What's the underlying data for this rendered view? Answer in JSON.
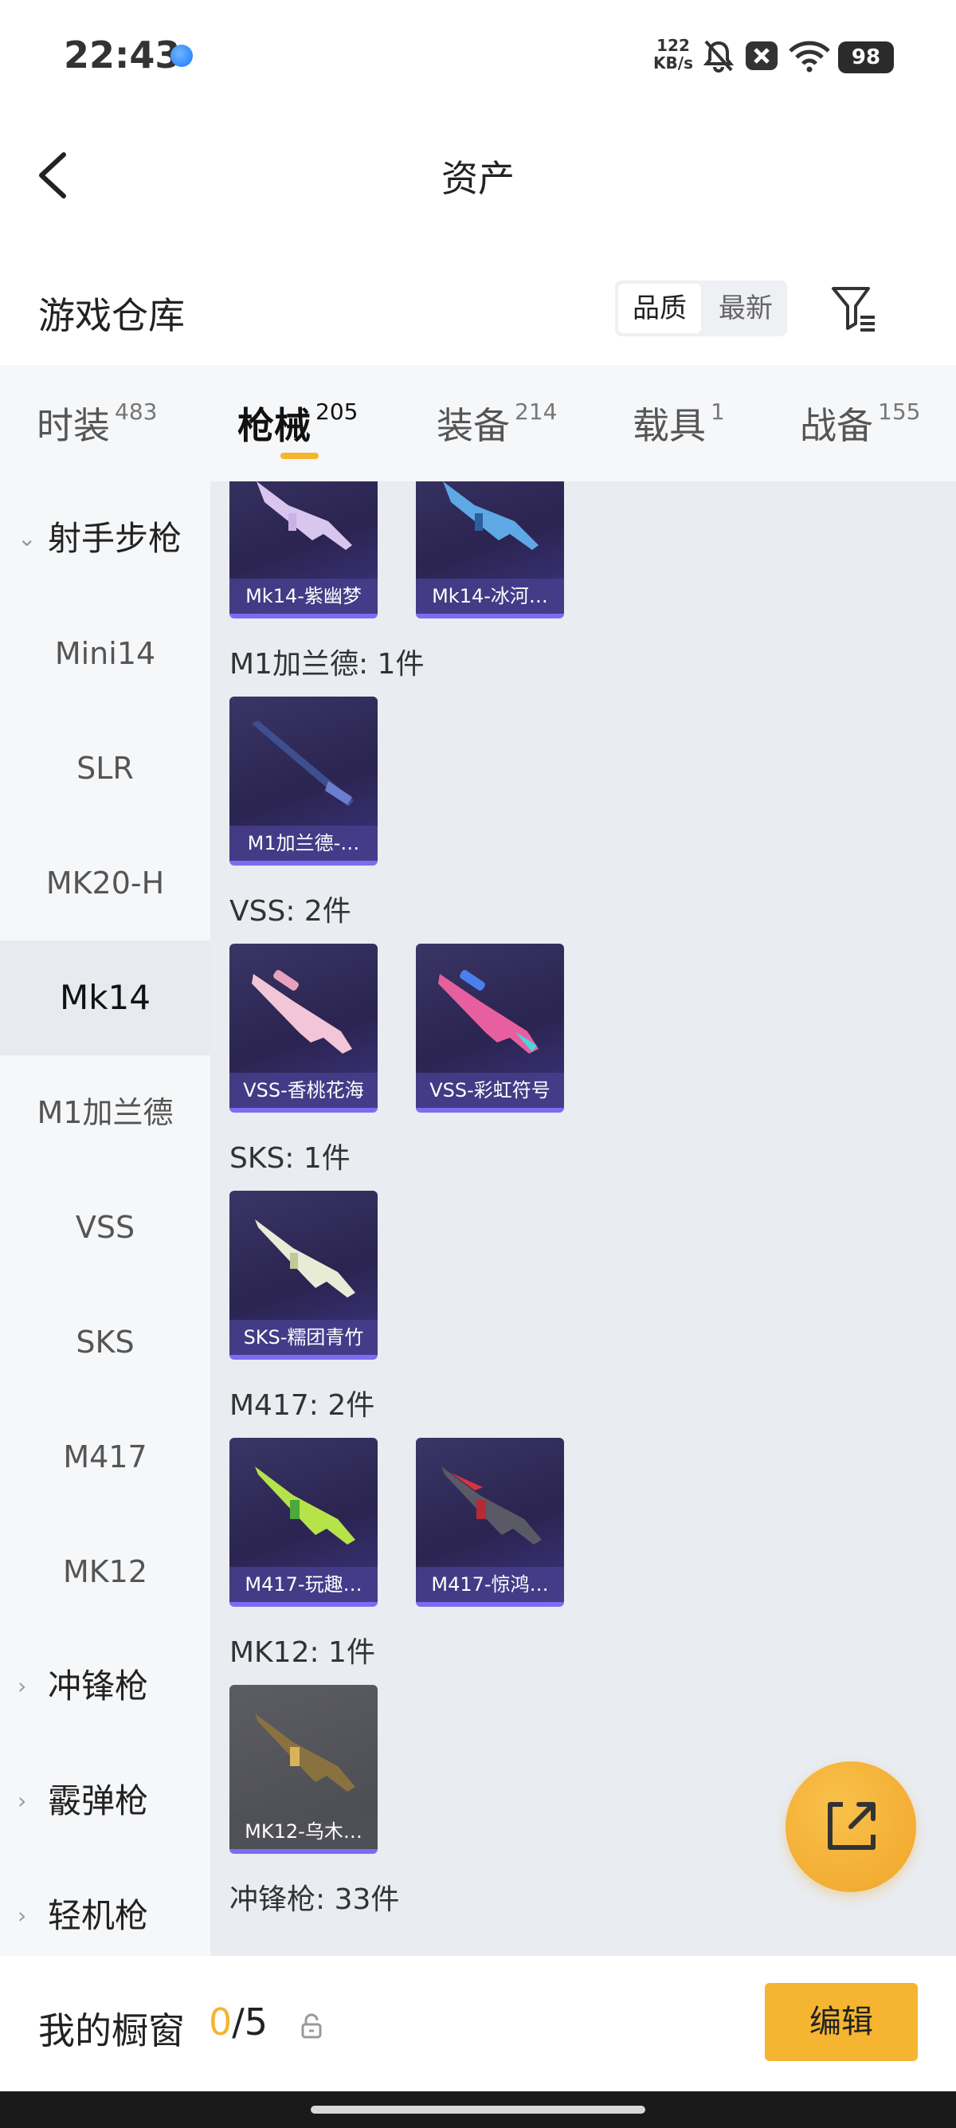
{
  "status_bar": {
    "time": "22:43",
    "speed_value": "122",
    "speed_unit": "KB/s",
    "battery": "98",
    "icons": [
      "app-dot-icon",
      "mute-bell-icon",
      "close-box-icon",
      "wifi-icon",
      "battery-icon"
    ]
  },
  "header": {
    "title": "资产",
    "back_icon": "chevron-left-icon"
  },
  "warehouse": {
    "title": "游戏仓库",
    "sort_options": [
      "品质",
      "最新"
    ],
    "sort_selected": "品质",
    "filter_icon": "filter-icon"
  },
  "tabs": [
    {
      "label": "时装",
      "count": "483",
      "active": false
    },
    {
      "label": "枪械",
      "count": "205",
      "active": true
    },
    {
      "label": "装备",
      "count": "214",
      "active": false
    },
    {
      "label": "载具",
      "count": "1",
      "active": false
    },
    {
      "label": "战备",
      "count": "155",
      "active": false
    }
  ],
  "sidebar": {
    "group_open": "射手步枪",
    "items": [
      "Mini14",
      "SLR",
      "MK20-H",
      "Mk14",
      "M1加兰德",
      "VSS",
      "SKS",
      "M417",
      "MK12"
    ],
    "active_item": "Mk14",
    "collapsed_groups": [
      "冲锋枪",
      "霰弹枪",
      "轻机枪"
    ]
  },
  "sections": [
    {
      "label": "",
      "items": [
        "Mk14-紫幽梦",
        "Mk14-冰河…"
      ]
    },
    {
      "label": "M1加兰德: 1件",
      "items": [
        "M1加兰德-…"
      ]
    },
    {
      "label": "VSS: 2件",
      "items": [
        "VSS-香桃花海",
        "VSS-彩虹符号"
      ]
    },
    {
      "label": "SKS: 1件",
      "items": [
        "SKS-糯团青竹"
      ]
    },
    {
      "label": "M417: 2件",
      "items": [
        "M417-玩趣…",
        "M417-惊鸿…"
      ]
    },
    {
      "label": "MK12: 1件",
      "items": [
        "MK12-乌木…"
      ]
    },
    {
      "label": "冲锋枪: 33件",
      "items": []
    }
  ],
  "fab": {
    "icon": "share-external-icon"
  },
  "bottom": {
    "showcase_label": "我的橱窗",
    "showcase_current": "0",
    "showcase_total": "/5",
    "lock_icon": "lock-icon",
    "edit_label": "编辑"
  },
  "colors": {
    "accent": "#f5b531",
    "card_purple": "#2b2450",
    "card_border": "#7b6cf0",
    "main_bg": "#e9ecf1",
    "sidebar_bg": "#f6f7f9"
  }
}
